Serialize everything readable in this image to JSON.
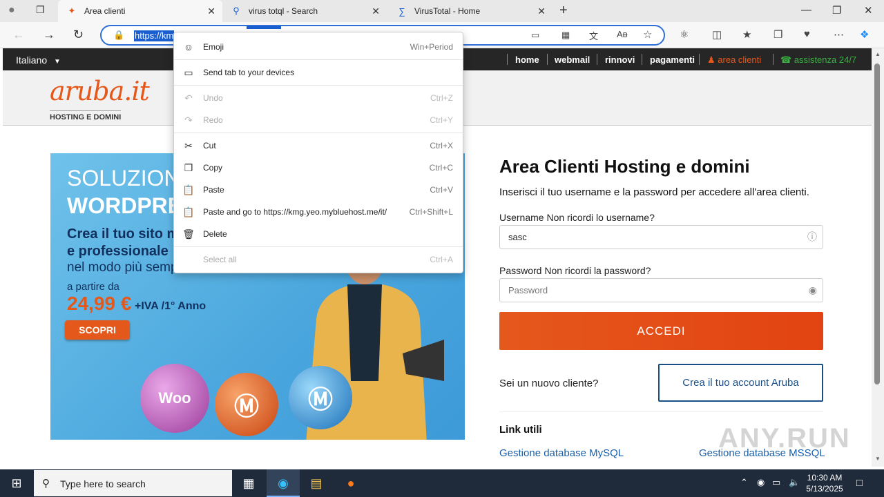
{
  "browser": {
    "tabs": [
      {
        "title": "Area clienti",
        "icon": "aruba-favicon-icon"
      },
      {
        "title": "virus totql - Search",
        "icon": "search-icon"
      },
      {
        "title": "VirusTotal - Home",
        "icon": "virustotal-icon"
      }
    ],
    "url_selected": "https://km"
  },
  "page": {
    "language": "Italiano",
    "topnav": [
      "home",
      "webmail",
      "rinnovi",
      "pagamenti",
      "area clienti",
      "assistenza 24/7"
    ],
    "logo": "aruba.it",
    "logo_sub": "HOSTING E DOMINI",
    "banner": {
      "title1": "SOLUZIONI",
      "title2": "WORDPRESS",
      "line1": "Crea il tuo sito mo",
      "line2": "e professionale",
      "line3": "nel modo più semp",
      "from": "a partire da",
      "price": "24,99 €",
      "iva": "+IVA /1° Anno",
      "cta": "SCOPRI",
      "ball_woo": "Woo"
    },
    "form": {
      "title": "Area Clienti Hosting e domini",
      "subtitle": "Inserisci il tuo username e la password per accedere all'area clienti.",
      "username_label": "Username Non ricordi lo username?",
      "username_value": "sasc",
      "password_label": "Password Non ricordi la password?",
      "password_placeholder": "Password",
      "submit": "ACCEDI",
      "new_client": "Sei un nuovo cliente?",
      "create_account": "Crea il tuo account Aruba",
      "links_title": "Link utili",
      "link_mysql": "Gestione database MySQL",
      "link_mssql": "Gestione database MSSQL"
    }
  },
  "context_menu": {
    "items": [
      {
        "label": "Emoji",
        "key": "Win+Period",
        "icon": "emoji-icon",
        "disabled": false
      },
      {
        "label": "Send tab to your devices",
        "key": "",
        "icon": "devices-icon",
        "disabled": false
      },
      {
        "label": "Undo",
        "key": "Ctrl+Z",
        "icon": "undo-icon",
        "disabled": true
      },
      {
        "label": "Redo",
        "key": "Ctrl+Y",
        "icon": "redo-icon",
        "disabled": true
      },
      {
        "label": "Cut",
        "key": "Ctrl+X",
        "icon": "cut-icon",
        "disabled": false
      },
      {
        "label": "Copy",
        "key": "Ctrl+C",
        "icon": "copy-icon",
        "disabled": false
      },
      {
        "label": "Paste",
        "key": "Ctrl+V",
        "icon": "paste-icon",
        "disabled": false
      },
      {
        "label": "Paste and go to https://kmg.yeo.mybluehost.me/it/",
        "key": "Ctrl+Shift+L",
        "icon": "paste-go-icon",
        "disabled": false
      },
      {
        "label": "Delete",
        "key": "",
        "icon": "delete-icon",
        "disabled": false
      },
      {
        "label": "Select all",
        "key": "Ctrl+A",
        "icon": "",
        "disabled": true
      }
    ]
  },
  "taskbar": {
    "search_placeholder": "Type here to search",
    "time": "10:30 AM",
    "date": "5/13/2025"
  },
  "watermark": "ANY.RUN",
  "colors": {
    "brand_orange": "#e5581c",
    "link_blue": "#1a5fa8",
    "support_green": "#3cb043"
  }
}
